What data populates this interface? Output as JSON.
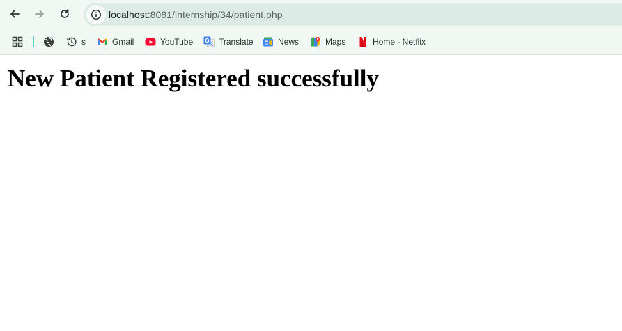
{
  "browser": {
    "url": {
      "host": "localhost",
      "rest": ":8081/internship/34/patient.php"
    },
    "bookmarks": [
      {
        "label": "",
        "icon": "globe-icon"
      },
      {
        "label": "s",
        "icon": "history-icon"
      },
      {
        "label": "Gmail",
        "icon": "gmail-icon"
      },
      {
        "label": "YouTube",
        "icon": "youtube-icon"
      },
      {
        "label": "Translate",
        "icon": "translate-icon"
      },
      {
        "label": "News",
        "icon": "news-icon"
      },
      {
        "label": "Maps",
        "icon": "maps-icon"
      },
      {
        "label": "Home - Netflix",
        "icon": "netflix-icon"
      }
    ],
    "colors": {
      "toolbar_bg": "#f1f8f4",
      "omnibox_bg": "#dcebe5",
      "bookmark_separator": "#5fd3c1"
    }
  },
  "page": {
    "heading": "New Patient Registered successfully"
  }
}
